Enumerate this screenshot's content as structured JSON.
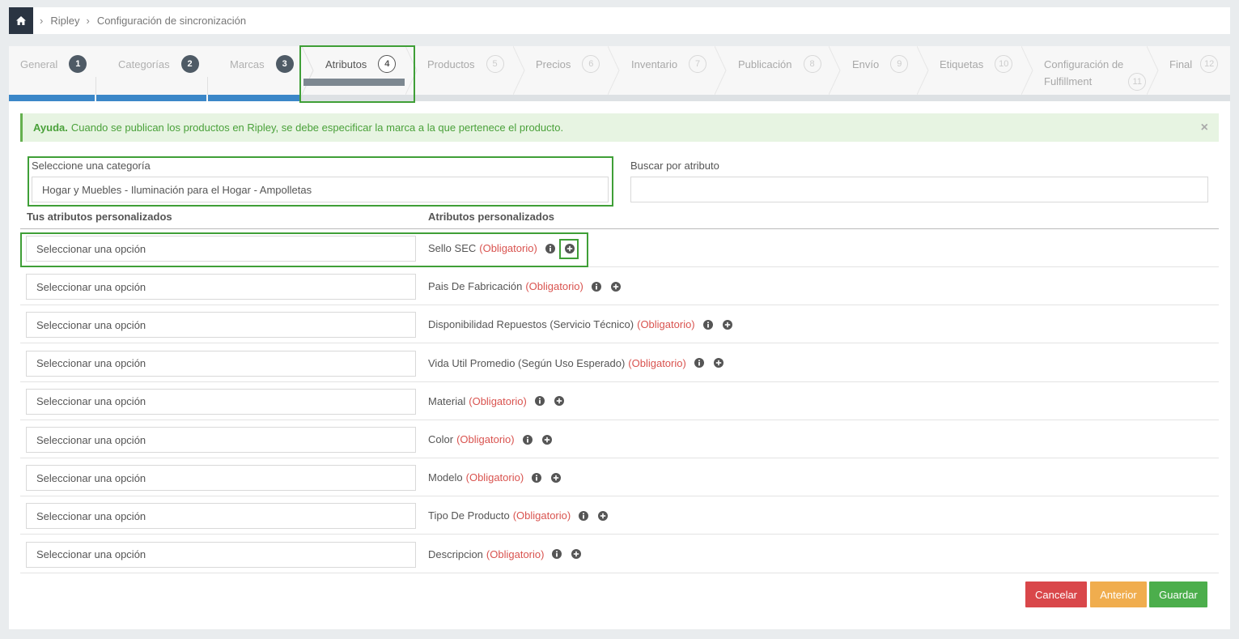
{
  "breadcrumb": {
    "items": [
      "Ripley",
      "Configuración de sincronización"
    ]
  },
  "wizard": {
    "steps": [
      {
        "label": "General",
        "num": "1"
      },
      {
        "label": "Categorías",
        "num": "2"
      },
      {
        "label": "Marcas",
        "num": "3"
      },
      {
        "label": "Atributos",
        "num": "4"
      },
      {
        "label": "Productos",
        "num": "5"
      },
      {
        "label": "Precios",
        "num": "6"
      },
      {
        "label": "Inventario",
        "num": "7"
      },
      {
        "label": "Publicación",
        "num": "8"
      },
      {
        "label": "Envío",
        "num": "9"
      },
      {
        "label": "Etiquetas",
        "num": "10"
      },
      {
        "label": "Configuración de",
        "label2": "Fulfillment",
        "num": "11"
      },
      {
        "label": "Final",
        "num": "12"
      }
    ]
  },
  "alert": {
    "title": "Ayuda.",
    "text": "Cuando se publican los productos en Ripley, se debe especificar la marca a la que pertenece el producto.",
    "close": "×"
  },
  "category": {
    "label": "Seleccione una categoría",
    "value": "Hogar y Muebles - Iluminación para el Hogar - Ampolletas"
  },
  "search": {
    "label": "Buscar por atributo",
    "value": ""
  },
  "columns": {
    "left": "Tus atributos personalizados",
    "right": "Atributos personalizados"
  },
  "rows": [
    {
      "select": "Seleccionar una opción",
      "attr": "Sello SEC",
      "req": "(Obligatorio)"
    },
    {
      "select": "Seleccionar una opción",
      "attr": "Pais De Fabricación",
      "req": "(Obligatorio)"
    },
    {
      "select": "Seleccionar una opción",
      "attr": "Disponibilidad Repuestos (Servicio Técnico)",
      "req": "(Obligatorio)"
    },
    {
      "select": "Seleccionar una opción",
      "attr": "Vida Util Promedio (Según Uso Esperado)",
      "req": "(Obligatorio)"
    },
    {
      "select": "Seleccionar una opción",
      "attr": "Material",
      "req": "(Obligatorio)"
    },
    {
      "select": "Seleccionar una opción",
      "attr": "Color",
      "req": "(Obligatorio)"
    },
    {
      "select": "Seleccionar una opción",
      "attr": "Modelo",
      "req": "(Obligatorio)"
    },
    {
      "select": "Seleccionar una opción",
      "attr": "Tipo De Producto",
      "req": "(Obligatorio)"
    },
    {
      "select": "Seleccionar una opción",
      "attr": "Descripcion",
      "req": "(Obligatorio)"
    }
  ],
  "buttons": {
    "cancel": "Cancelar",
    "prev": "Anterior",
    "save": "Guardar"
  },
  "colors": {
    "done_bar": "#3b87c8",
    "highlight": "#3f9f37",
    "required": "#d9534f",
    "alert_text": "#4aa13a"
  }
}
